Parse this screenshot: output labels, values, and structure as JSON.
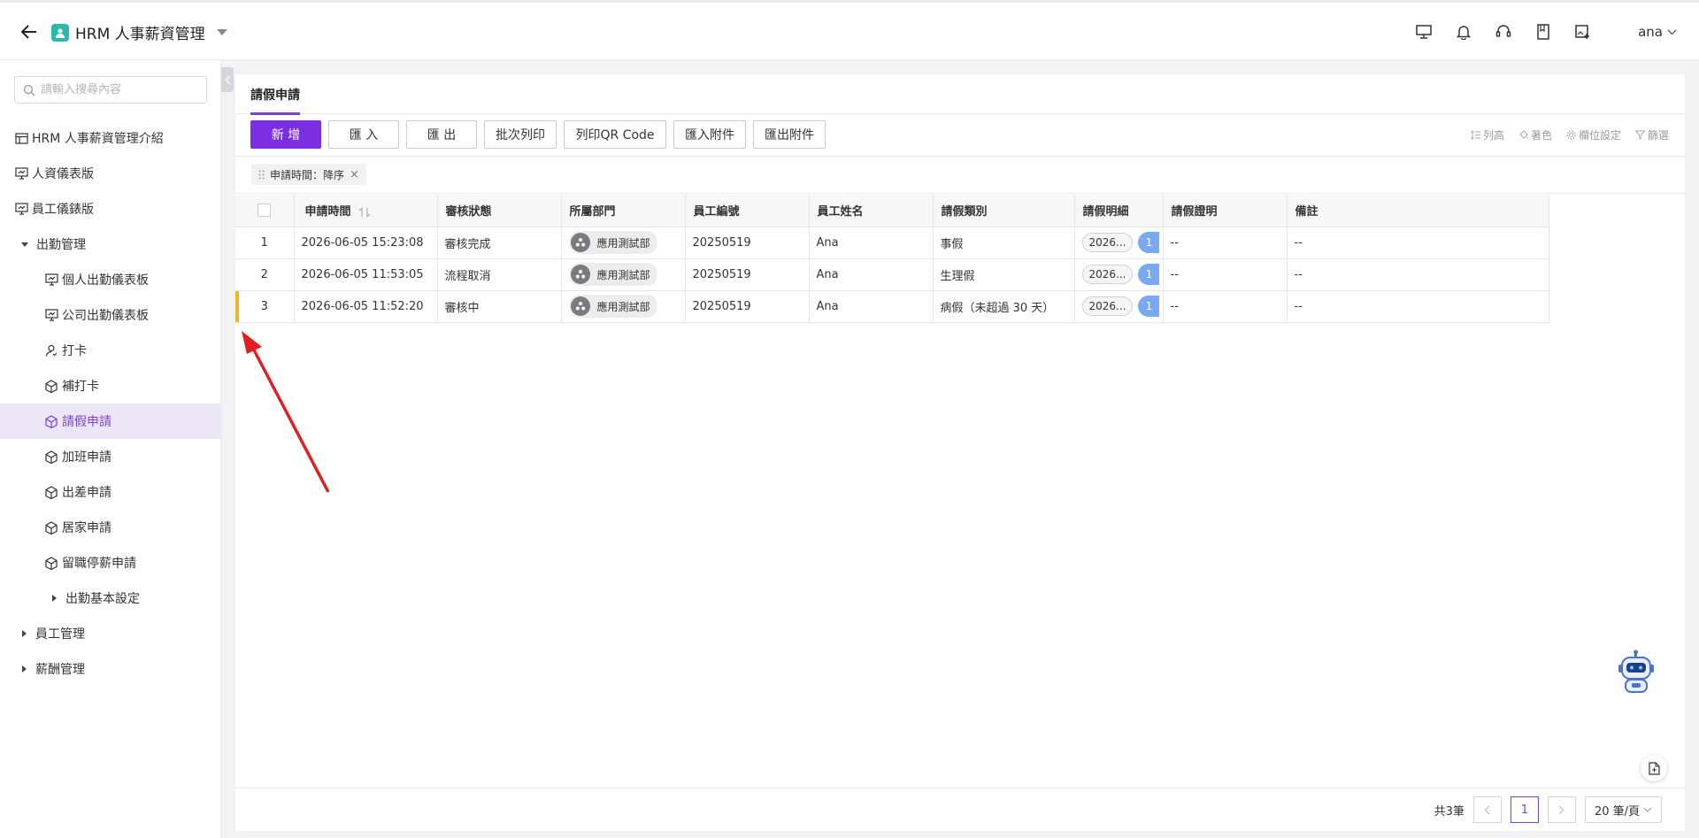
{
  "header": {
    "app_title": "HRM 人事薪資管理",
    "user": "ana",
    "icons": [
      "monitor-icon",
      "bell-icon",
      "headset-icon",
      "book-icon",
      "image-add-icon"
    ]
  },
  "sidebar": {
    "search_placeholder": "請輸入搜尋內容",
    "items": [
      {
        "label": "HRM 人事薪資管理介紹",
        "icon": "table-icon"
      },
      {
        "label": "人資儀表版",
        "icon": "dashboard-icon"
      },
      {
        "label": "員工儀錶版",
        "icon": "dashboard-icon"
      },
      {
        "label": "出勤管理",
        "icon": "caret-down-icon"
      },
      {
        "label": "個人出勤儀表板",
        "icon": "dashboard-icon"
      },
      {
        "label": "公司出勤儀表板",
        "icon": "dashboard-icon"
      },
      {
        "label": "打卡",
        "icon": "user-icon"
      },
      {
        "label": "補打卡",
        "icon": "cube-icon"
      },
      {
        "label": "請假申請",
        "icon": "cube-icon"
      },
      {
        "label": "加班申請",
        "icon": "cube-icon"
      },
      {
        "label": "出差申請",
        "icon": "cube-icon"
      },
      {
        "label": "居家申請",
        "icon": "cube-icon"
      },
      {
        "label": "留職停薪申請",
        "icon": "cube-icon"
      },
      {
        "label": "出勤基本設定",
        "icon": "caret-right-icon"
      },
      {
        "label": "員工管理",
        "icon": "caret-right-icon"
      },
      {
        "label": "薪酬管理",
        "icon": "caret-right-icon"
      }
    ]
  },
  "main": {
    "tab": "請假申請",
    "buttons": {
      "add": "新 增",
      "import": "匯 入",
      "export": "匯 出",
      "batch_print": "批次列印",
      "print_qr": "列印QR Code",
      "import_attach": "匯入附件",
      "export_attach": "匯出附件"
    },
    "tools": {
      "row_height": "列高",
      "color": "著色",
      "field_settings": "欄位設定",
      "filter": "篩選"
    },
    "sort_chip": "申請時間：降序"
  },
  "table": {
    "columns": [
      "申請時間",
      "審核狀態",
      "所屬部門",
      "員工編號",
      "員工姓名",
      "請假類別",
      "請假明細",
      "請假證明",
      "備註"
    ],
    "rows": [
      {
        "idx": "1",
        "time": "2026-06-05 15:23:08",
        "status": "審核完成",
        "dept": "應用測試部",
        "emp_no": "20250519",
        "name": "Ana",
        "type": "事假",
        "detail": "2026...",
        "count": "1",
        "proof": "--",
        "note": "--"
      },
      {
        "idx": "2",
        "time": "2026-06-05 11:53:05",
        "status": "流程取消",
        "dept": "應用測試部",
        "emp_no": "20250519",
        "name": "Ana",
        "type": "生理假",
        "detail": "2026...",
        "count": "1",
        "proof": "--",
        "note": "--"
      },
      {
        "idx": "3",
        "time": "2026-06-05 11:52:20",
        "status": "審核中",
        "dept": "應用測試部",
        "emp_no": "20250519",
        "name": "Ana",
        "type": "病假（未超過 30 天）",
        "detail": "2026...",
        "count": "1",
        "proof": "--",
        "note": "--"
      }
    ]
  },
  "pager": {
    "total": "共3筆",
    "current": "1",
    "size": "20 筆/頁"
  },
  "colors": {
    "accent": "#7b2fe0",
    "row_marker": "#f0b429",
    "arrow": "#e02020"
  }
}
